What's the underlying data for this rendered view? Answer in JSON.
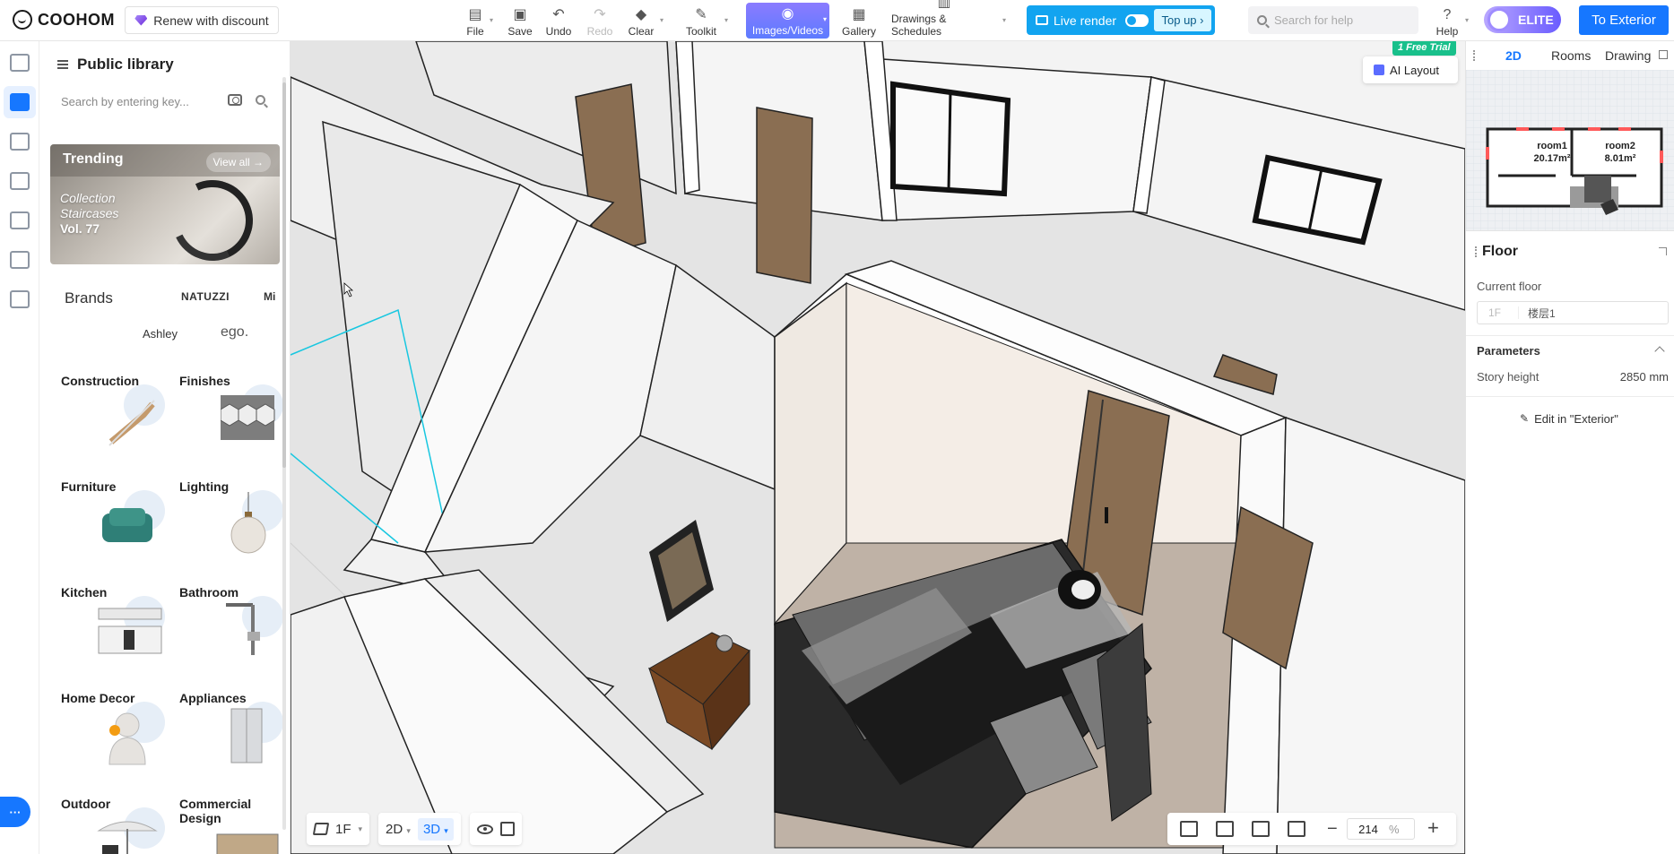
{
  "app": {
    "logo_text": "COOHOM"
  },
  "topbar": {
    "renew_label": "Renew with discount",
    "tools": [
      {
        "label": "File",
        "icon": "file-icon",
        "glyph": "▤"
      },
      {
        "label": "Save",
        "icon": "save-icon",
        "glyph": "▣"
      },
      {
        "label": "Undo",
        "icon": "undo-icon",
        "glyph": "↶"
      },
      {
        "label": "Redo",
        "icon": "redo-icon",
        "glyph": "↷"
      },
      {
        "label": "Clear",
        "icon": "clear-icon",
        "glyph": "◆"
      },
      {
        "label": "Toolkit",
        "icon": "wrench-icon",
        "glyph": "✎"
      },
      {
        "label": "Images/Videos",
        "icon": "camera-icon",
        "glyph": "◉"
      },
      {
        "label": "Gallery",
        "icon": "gallery-icon",
        "glyph": "▦"
      },
      {
        "label": "Drawings & Schedules",
        "icon": "drawings-icon",
        "glyph": "▥"
      }
    ],
    "live_render_label": "Live render",
    "top_up_label": "Top up",
    "help_search_placeholder": "Search for help",
    "help_label": "Help",
    "elite_label": "ELITE",
    "to_exterior_label": "To Exterior"
  },
  "chat": {
    "label": "···"
  },
  "library": {
    "title": "Public library",
    "search_placeholder": "Search by entering key...",
    "trending": {
      "title": "Trending",
      "view_all": "View all",
      "caption_line1": "Collection",
      "caption_line2": "Staircases",
      "caption_vol": "Vol. 77"
    },
    "brands_label": "Brands",
    "brands": [
      "NATUZZI",
      "Mi",
      "Ashley",
      "ego."
    ],
    "categories": [
      "Construction",
      "Finishes",
      "Furniture",
      "Lighting",
      "Kitchen",
      "Bathroom",
      "Home Decor",
      "Appliances",
      "Outdoor",
      "Commercial Design"
    ]
  },
  "viewport": {
    "ai_layout_label": "AI Layout",
    "free_trial_badge": "1 Free Trial",
    "floor_selector": "1F",
    "view_2d": "2D",
    "view_3d": "3D",
    "zoom_value": "214",
    "zoom_unit": "%"
  },
  "right_panel": {
    "tabs": [
      "2D",
      "Rooms",
      "Drawing"
    ],
    "active_tab": "2D",
    "rooms": [
      {
        "name": "room1",
        "area": "20.17m²"
      },
      {
        "name": "room2",
        "area": "8.01m²"
      }
    ],
    "floor": {
      "title": "Floor",
      "current_floor_label": "Current floor",
      "floor_code": "1F",
      "floor_name": "楼层1",
      "parameters_label": "Parameters",
      "story_height_label": "Story height",
      "story_height_value": "2850 mm",
      "edit_link": "Edit in  \"Exterior\""
    }
  }
}
